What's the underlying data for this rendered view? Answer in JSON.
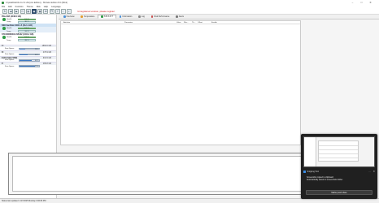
{
  "window": {
    "title": "CrystalDiskInfo 9.2.3 x64 [Aoi Edition] - Shizuku Edition 8.0 (64bit)",
    "controls": [
      "–",
      "□",
      "✕"
    ]
  },
  "menu": [
    "File",
    "Edit",
    "Function",
    "Theme",
    "Disk",
    "Help",
    "Language"
  ],
  "toolbar": {
    "notice": "Unregistered version, please register."
  },
  "devices": [
    {
      "name": "PNa 2GB (2048.0 GB)",
      "health_label": "Health",
      "health_value": "100 %",
      "temp_label": "Temp",
      "temp_value": "36 °C"
    },
    {
      "name": "SSD SanDisk X400 2.5 (512.1 GB)",
      "health_label": "Health",
      "health_value": "100 %",
      "temp_label": "Temp",
      "temp_value": "31 °C"
    },
    {
      "name": "ST1000DM003-1SB102 (1000.2 GB)",
      "health_label": "Health",
      "health_value": "100 %",
      "temp_label": "Temp",
      "temp_value": "28 °C"
    }
  ],
  "volumes": [
    {
      "name": "C:",
      "size": "1863.0 GB",
      "free_label": "Free Space",
      "free_value": "28 %",
      "free_pct": 28
    },
    {
      "name": "D:",
      "size": "476.9 GB",
      "free_label": "Free Space",
      "free_value": "40 %",
      "free_pct": 40
    },
    {
      "name": "E:(Portable SSD)",
      "size": "931.5 GB",
      "free_label": "Free Space",
      "free_value": "60 %",
      "free_pct": 60
    },
    {
      "name": "F:",
      "size": "465.8 GB",
      "free_label": "Free Space",
      "free_value": "77 %",
      "free_pct": 77
    }
  ],
  "tabs": [
    {
      "label": "Overview",
      "color": "#4a90d9"
    },
    {
      "label": "Temperature",
      "color": "#e39b2f"
    },
    {
      "label": "S.M.A.R.T",
      "color": "#2e9b46",
      "active": true
    },
    {
      "label": "Information",
      "color": "#4a90d9"
    },
    {
      "label": "Log",
      "color": "#888"
    },
    {
      "label": "Disk Performance",
      "color": "#c94d4d"
    },
    {
      "label": "Alerts",
      "color": "#777"
    }
  ],
  "table": {
    "columns": [
      "Attribute",
      "Parameter",
      "Value",
      "Wor...",
      "Th...",
      "Offset",
      "Enable"
    ]
  },
  "statusbar": {
    "text": "Status last updated: 1/17/2025 Monday 3:06:06 PM"
  },
  "toast": {
    "app_name": "Snipping Tool",
    "message": "Screenshot copied to clipboard",
    "message2": "Automatically saved to screenshots folder.",
    "button": "Markup and share"
  }
}
